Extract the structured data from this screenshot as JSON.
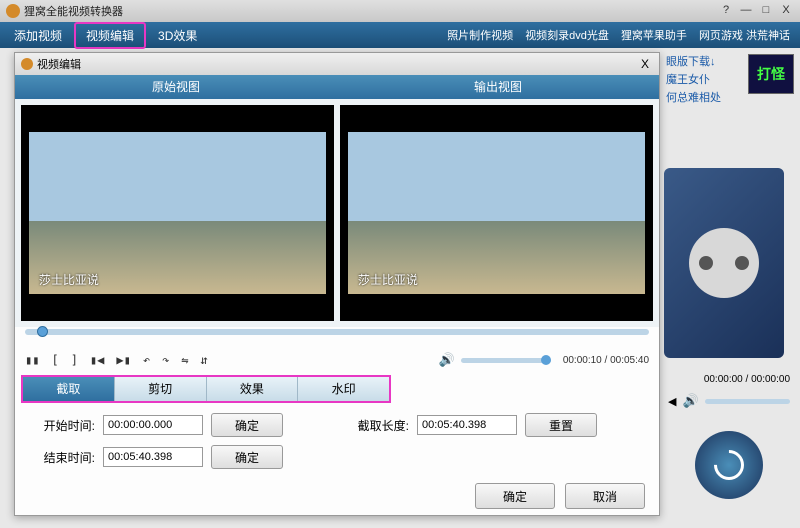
{
  "app": {
    "title": "狸窝全能视频转换器"
  },
  "window_controls": {
    "min": "—",
    "max": "□",
    "close": "X"
  },
  "menu": {
    "items": [
      "添加视频",
      "视频编辑",
      "3D效果"
    ],
    "right": [
      "照片制作视频",
      "视频刻录dvd光盘",
      "狸窝苹果助手",
      "网页游戏 洪荒神话"
    ]
  },
  "editor": {
    "title": "视频编辑",
    "close": "X",
    "views": {
      "left": "原始视图",
      "right": "输出视图"
    },
    "subtitle": "莎士比亚说",
    "controls": {
      "pause": "▮▮",
      "in": "[",
      "out": "]",
      "prev": "▮◀",
      "next": "▶▮",
      "rotl": "↶",
      "rotr": "↷",
      "fliph": "⇋",
      "flipv": "⇵"
    },
    "timecode": "00:00:10 / 00:05:40",
    "tabs": [
      "截取",
      "剪切",
      "效果",
      "水印"
    ],
    "form": {
      "start_label": "开始时间:",
      "start_val": "00:00:00.000",
      "end_label": "结束时间:",
      "end_val": "00:05:40.398",
      "confirm": "确定",
      "length_label": "截取长度:",
      "length_val": "00:05:40.398",
      "reset": "重置"
    },
    "ok": "确定",
    "cancel": "取消"
  },
  "side": {
    "links": [
      "眼版下载↓",
      "魔王女仆",
      "何总难相处"
    ],
    "banner": "打怪",
    "time": "00:00:00 / 00:00:00"
  },
  "chart_data": null
}
